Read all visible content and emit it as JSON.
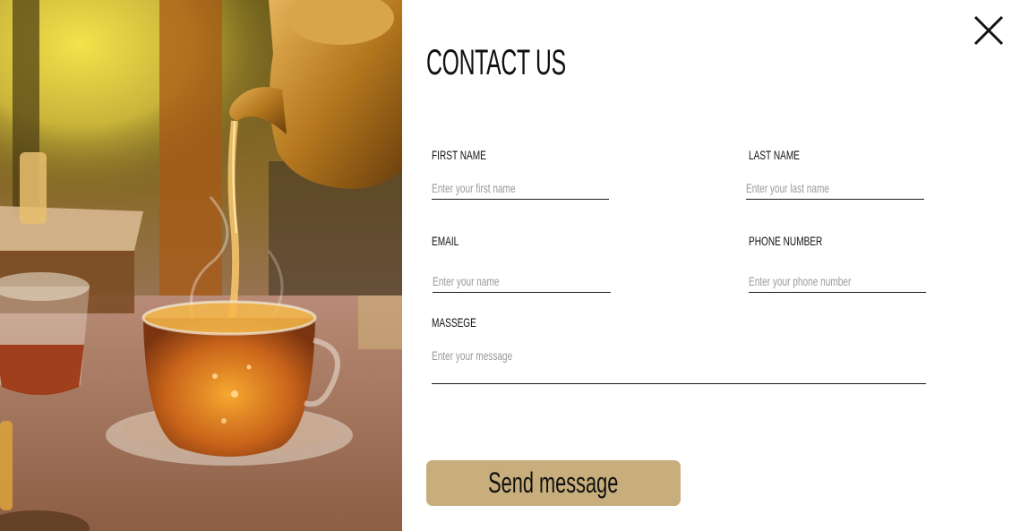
{
  "title": "CONTACT US",
  "form": {
    "first_name": {
      "label": "FIRST NAME",
      "placeholder": "Enter your first name",
      "value": ""
    },
    "last_name": {
      "label": "LAST NAME",
      "placeholder": "Enter your last name",
      "value": ""
    },
    "email": {
      "label": "EMAIL",
      "placeholder": "Enter your name",
      "value": ""
    },
    "phone": {
      "label": "PHONE NUMBER",
      "placeholder": "Enter your phone number",
      "value": ""
    },
    "message": {
      "label": "MASSEGE",
      "placeholder": "Enter your message",
      "value": ""
    }
  },
  "submit_label": "Send message",
  "icons": {
    "close": "close-icon"
  },
  "colors": {
    "button": "#c8ae7c",
    "text": "#111111",
    "placeholder": "#9a9a9a"
  }
}
